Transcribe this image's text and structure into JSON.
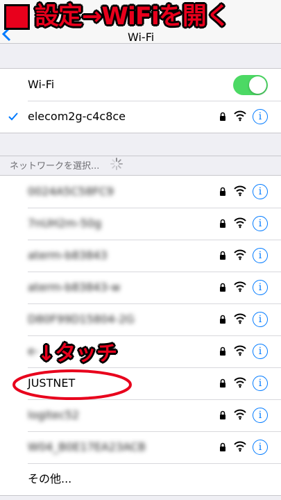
{
  "banner": {
    "title": "設定→WiFiを開く"
  },
  "nav": {
    "title": "Wi-Fi"
  },
  "wifi_toggle": {
    "label": "Wi-Fi",
    "enabled": true
  },
  "connected": {
    "name": "elecom2g-c4c8ce"
  },
  "section_header": "ネットワークを選択...",
  "networks": [
    {
      "name": "0024A5C58FC9"
    },
    {
      "name": "7nUH2m-50g"
    },
    {
      "name": "aterm-b83843"
    },
    {
      "name": "aterm-b83843-w"
    },
    {
      "name": "D80F99D15804-2G"
    },
    {
      "name": "e-"
    },
    {
      "name": "JUSTNET"
    },
    {
      "name": "logitec52"
    },
    {
      "name": "W04_B0E17EA23ACB"
    }
  ],
  "other": "その他...",
  "annotation": {
    "tap": "↓タッチ"
  },
  "colors": {
    "accent": "#007aff",
    "toggle_on": "#4cd964",
    "annotation": "#e8001c"
  }
}
